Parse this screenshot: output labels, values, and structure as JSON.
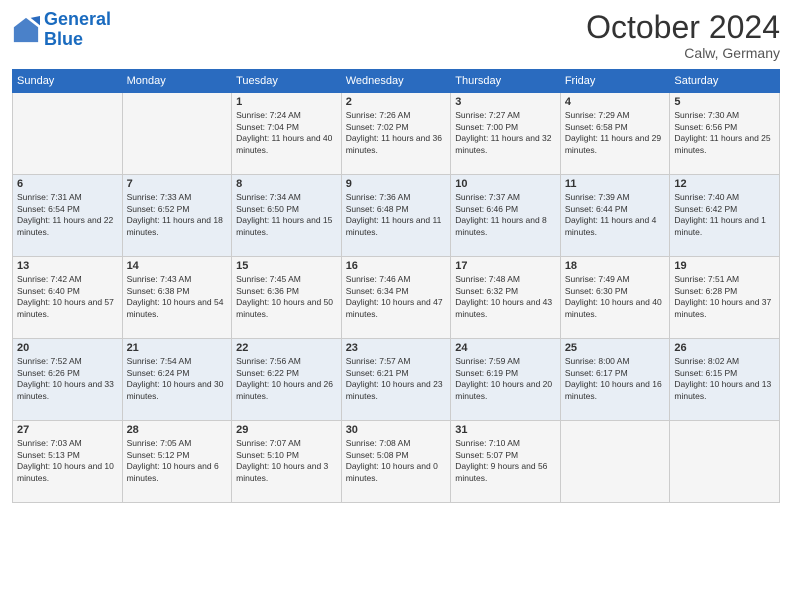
{
  "header": {
    "logo_line1": "General",
    "logo_line2": "Blue",
    "month": "October 2024",
    "location": "Calw, Germany"
  },
  "weekdays": [
    "Sunday",
    "Monday",
    "Tuesday",
    "Wednesday",
    "Thursday",
    "Friday",
    "Saturday"
  ],
  "rows": [
    [
      {
        "day": "",
        "info": ""
      },
      {
        "day": "",
        "info": ""
      },
      {
        "day": "1",
        "info": "Sunrise: 7:24 AM\nSunset: 7:04 PM\nDaylight: 11 hours and 40 minutes."
      },
      {
        "day": "2",
        "info": "Sunrise: 7:26 AM\nSunset: 7:02 PM\nDaylight: 11 hours and 36 minutes."
      },
      {
        "day": "3",
        "info": "Sunrise: 7:27 AM\nSunset: 7:00 PM\nDaylight: 11 hours and 32 minutes."
      },
      {
        "day": "4",
        "info": "Sunrise: 7:29 AM\nSunset: 6:58 PM\nDaylight: 11 hours and 29 minutes."
      },
      {
        "day": "5",
        "info": "Sunrise: 7:30 AM\nSunset: 6:56 PM\nDaylight: 11 hours and 25 minutes."
      }
    ],
    [
      {
        "day": "6",
        "info": "Sunrise: 7:31 AM\nSunset: 6:54 PM\nDaylight: 11 hours and 22 minutes."
      },
      {
        "day": "7",
        "info": "Sunrise: 7:33 AM\nSunset: 6:52 PM\nDaylight: 11 hours and 18 minutes."
      },
      {
        "day": "8",
        "info": "Sunrise: 7:34 AM\nSunset: 6:50 PM\nDaylight: 11 hours and 15 minutes."
      },
      {
        "day": "9",
        "info": "Sunrise: 7:36 AM\nSunset: 6:48 PM\nDaylight: 11 hours and 11 minutes."
      },
      {
        "day": "10",
        "info": "Sunrise: 7:37 AM\nSunset: 6:46 PM\nDaylight: 11 hours and 8 minutes."
      },
      {
        "day": "11",
        "info": "Sunrise: 7:39 AM\nSunset: 6:44 PM\nDaylight: 11 hours and 4 minutes."
      },
      {
        "day": "12",
        "info": "Sunrise: 7:40 AM\nSunset: 6:42 PM\nDaylight: 11 hours and 1 minute."
      }
    ],
    [
      {
        "day": "13",
        "info": "Sunrise: 7:42 AM\nSunset: 6:40 PM\nDaylight: 10 hours and 57 minutes."
      },
      {
        "day": "14",
        "info": "Sunrise: 7:43 AM\nSunset: 6:38 PM\nDaylight: 10 hours and 54 minutes."
      },
      {
        "day": "15",
        "info": "Sunrise: 7:45 AM\nSunset: 6:36 PM\nDaylight: 10 hours and 50 minutes."
      },
      {
        "day": "16",
        "info": "Sunrise: 7:46 AM\nSunset: 6:34 PM\nDaylight: 10 hours and 47 minutes."
      },
      {
        "day": "17",
        "info": "Sunrise: 7:48 AM\nSunset: 6:32 PM\nDaylight: 10 hours and 43 minutes."
      },
      {
        "day": "18",
        "info": "Sunrise: 7:49 AM\nSunset: 6:30 PM\nDaylight: 10 hours and 40 minutes."
      },
      {
        "day": "19",
        "info": "Sunrise: 7:51 AM\nSunset: 6:28 PM\nDaylight: 10 hours and 37 minutes."
      }
    ],
    [
      {
        "day": "20",
        "info": "Sunrise: 7:52 AM\nSunset: 6:26 PM\nDaylight: 10 hours and 33 minutes."
      },
      {
        "day": "21",
        "info": "Sunrise: 7:54 AM\nSunset: 6:24 PM\nDaylight: 10 hours and 30 minutes."
      },
      {
        "day": "22",
        "info": "Sunrise: 7:56 AM\nSunset: 6:22 PM\nDaylight: 10 hours and 26 minutes."
      },
      {
        "day": "23",
        "info": "Sunrise: 7:57 AM\nSunset: 6:21 PM\nDaylight: 10 hours and 23 minutes."
      },
      {
        "day": "24",
        "info": "Sunrise: 7:59 AM\nSunset: 6:19 PM\nDaylight: 10 hours and 20 minutes."
      },
      {
        "day": "25",
        "info": "Sunrise: 8:00 AM\nSunset: 6:17 PM\nDaylight: 10 hours and 16 minutes."
      },
      {
        "day": "26",
        "info": "Sunrise: 8:02 AM\nSunset: 6:15 PM\nDaylight: 10 hours and 13 minutes."
      }
    ],
    [
      {
        "day": "27",
        "info": "Sunrise: 7:03 AM\nSunset: 5:13 PM\nDaylight: 10 hours and 10 minutes."
      },
      {
        "day": "28",
        "info": "Sunrise: 7:05 AM\nSunset: 5:12 PM\nDaylight: 10 hours and 6 minutes."
      },
      {
        "day": "29",
        "info": "Sunrise: 7:07 AM\nSunset: 5:10 PM\nDaylight: 10 hours and 3 minutes."
      },
      {
        "day": "30",
        "info": "Sunrise: 7:08 AM\nSunset: 5:08 PM\nDaylight: 10 hours and 0 minutes."
      },
      {
        "day": "31",
        "info": "Sunrise: 7:10 AM\nSunset: 5:07 PM\nDaylight: 9 hours and 56 minutes."
      },
      {
        "day": "",
        "info": ""
      },
      {
        "day": "",
        "info": ""
      }
    ]
  ]
}
